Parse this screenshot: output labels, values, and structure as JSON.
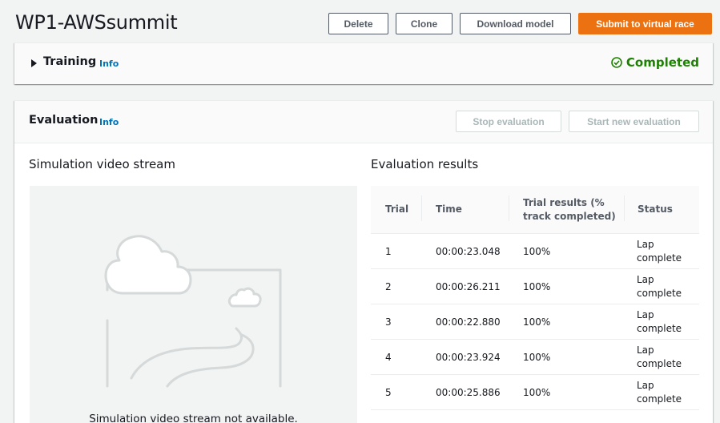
{
  "header": {
    "title": "WP1-AWSsummit",
    "delete_label": "Delete",
    "clone_label": "Clone",
    "download_label": "Download model",
    "submit_label": "Submit to virtual race"
  },
  "training": {
    "title": "Training",
    "info_label": "Info",
    "status": "Completed"
  },
  "evaluation": {
    "title": "Evaluation",
    "info_label": "Info",
    "stop_label": "Stop evaluation",
    "start_label": "Start new evaluation",
    "video_title": "Simulation video stream",
    "video_unavailable": "Simulation video stream not available.",
    "results_title": "Evaluation results",
    "columns": [
      "Trial",
      "Time",
      "Trial results (% track completed)",
      "Status"
    ],
    "rows": [
      {
        "trial": "1",
        "time": "00:00:23.048",
        "result": "100%",
        "status": "Lap complete"
      },
      {
        "trial": "2",
        "time": "00:00:26.211",
        "result": "100%",
        "status": "Lap complete"
      },
      {
        "trial": "3",
        "time": "00:00:22.880",
        "result": "100%",
        "status": "Lap complete"
      },
      {
        "trial": "4",
        "time": "00:00:23.924",
        "result": "100%",
        "status": "Lap complete"
      },
      {
        "trial": "5",
        "time": "00:00:25.886",
        "result": "100%",
        "status": "Lap complete"
      }
    ]
  },
  "colors": {
    "primary": "#ec7211",
    "success": "#1d8102",
    "link": "#0073bb"
  }
}
